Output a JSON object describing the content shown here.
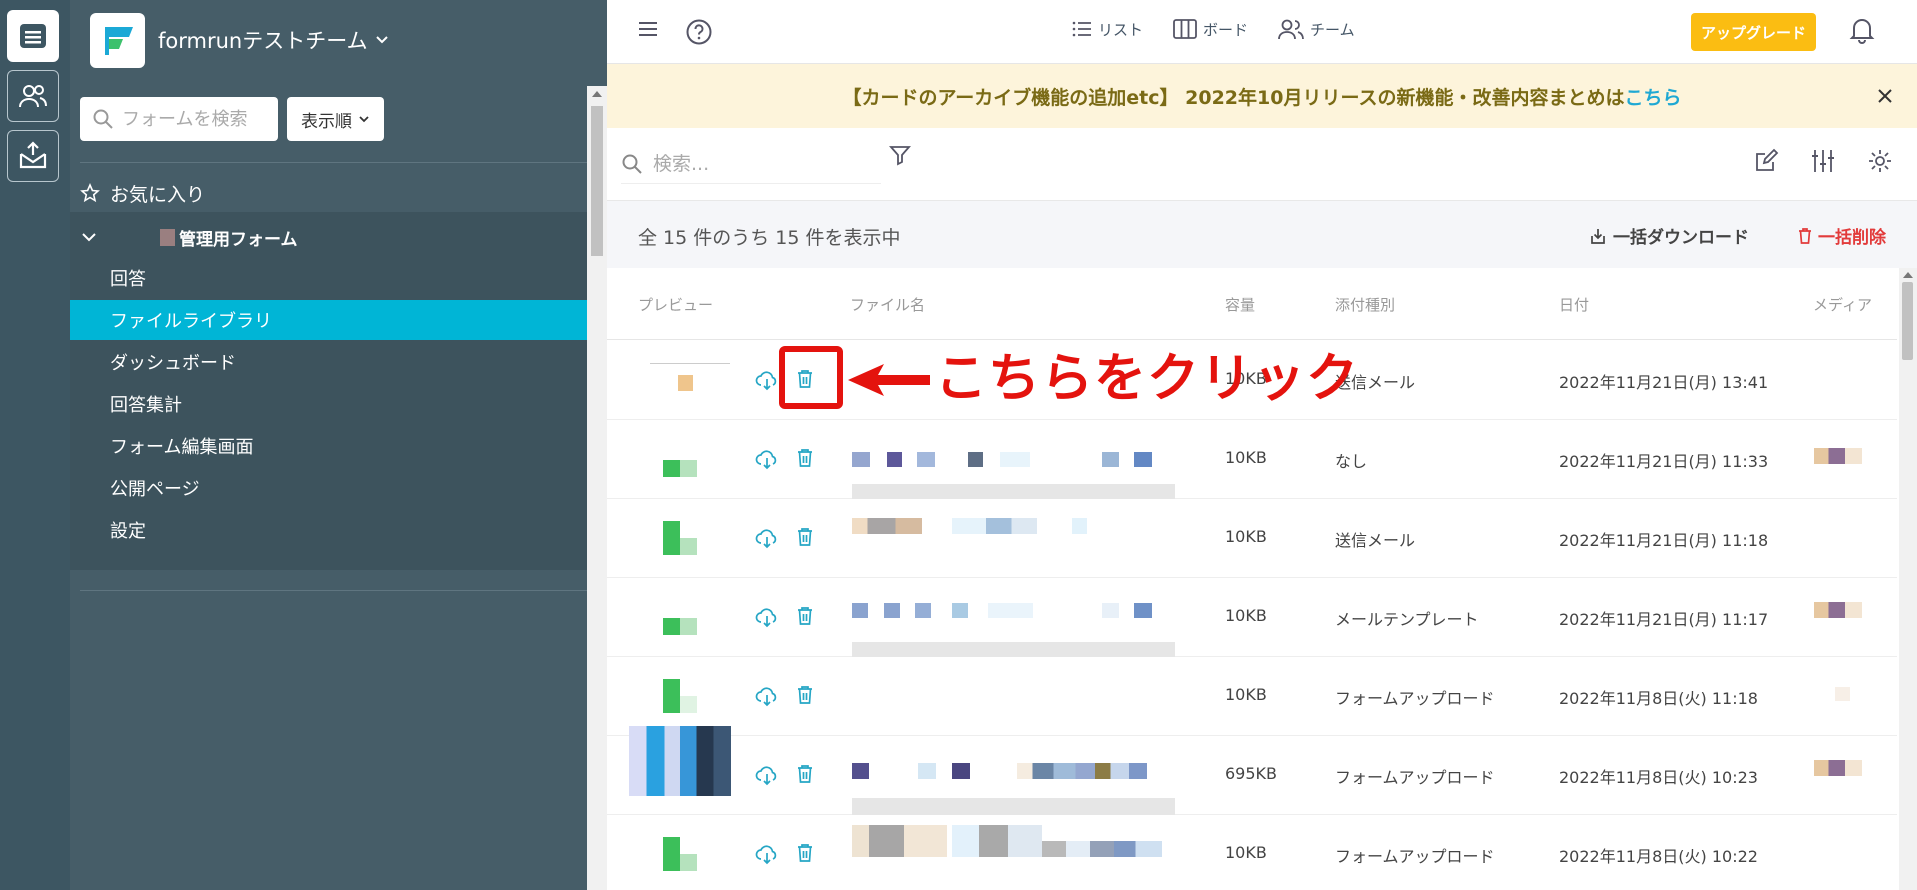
{
  "rail": {
    "items": [
      "form-list-icon",
      "team-icon",
      "inbox-icon"
    ]
  },
  "sidebar": {
    "team_name": "formrunテストチーム",
    "search_placeholder": "フォームを検索",
    "sort_label": "表示順",
    "favorites_label": "お気に入り",
    "form_name": "管理用フォーム",
    "items": [
      {
        "label": "回答"
      },
      {
        "label": "ファイルライブラリ"
      },
      {
        "label": "ダッシュボード"
      },
      {
        "label": "回答集計"
      },
      {
        "label": "フォーム編集画面"
      },
      {
        "label": "公開ページ"
      },
      {
        "label": "設定"
      }
    ]
  },
  "topbar": {
    "nav": [
      {
        "label": "リスト"
      },
      {
        "label": "ボード"
      },
      {
        "label": "チーム"
      }
    ],
    "upgrade_label": "アップグレード"
  },
  "banner": {
    "text": "【カードのアーカイブ機能の追加etc】 2022年10月リリースの新機能・改善内容まとめは",
    "link": "こちら"
  },
  "toolbar": {
    "search_placeholder": "検索..."
  },
  "summary": {
    "text": "全 15 件のうち 15 件を表示中",
    "bulk_download": "一括ダウンロード",
    "bulk_delete": "一括削除"
  },
  "table": {
    "headers": {
      "preview": "プレビュー",
      "filename": "ファイル名",
      "size": "容量",
      "attach_type": "添付種別",
      "date": "日付",
      "media": "メディア"
    },
    "rows": [
      {
        "size": "10KB",
        "type": "送信メール",
        "date": "2022年11月21日(月) 13:41"
      },
      {
        "size": "10KB",
        "type": "なし",
        "date": "2022年11月21日(月) 11:33"
      },
      {
        "size": "10KB",
        "type": "送信メール",
        "date": "2022年11月21日(月) 11:18"
      },
      {
        "size": "10KB",
        "type": "メールテンプレート",
        "date": "2022年11月21日(月) 11:17"
      },
      {
        "size": "10KB",
        "type": "フォームアップロード",
        "date": "2022年11月8日(火) 11:18"
      },
      {
        "size": "695KB",
        "type": "フォームアップロード",
        "date": "2022年11月8日(火) 10:23"
      },
      {
        "size": "10KB",
        "type": "フォームアップロード",
        "date": "2022年11月8日(火) 10:22"
      }
    ]
  },
  "annotation": {
    "text": "こちらをクリック",
    "color": "#e4130e"
  },
  "colors": {
    "accent": "#00b5d6",
    "upgrade": "#fbbd12",
    "danger": "#e23b3b",
    "sidebar": "#465d68"
  }
}
